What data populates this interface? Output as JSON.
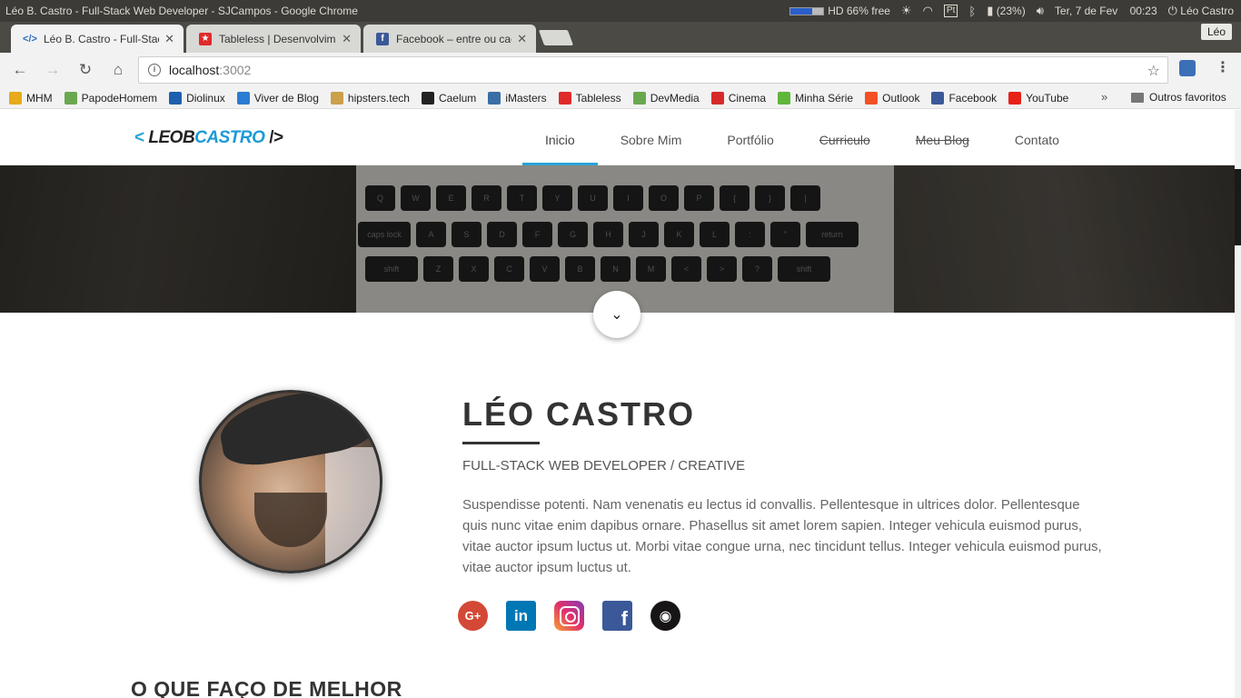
{
  "os": {
    "window_title": "Léo B. Castro - Full-Stack Web Developer - SJCampos - Google Chrome",
    "disk": "HD 66% free",
    "disk_free_fraction": 0.66,
    "keyboard": "Pt",
    "battery": "(23%)",
    "date": "Ter,  7 de Fev",
    "time": "00:23",
    "user": "Léo Castro"
  },
  "tabs": [
    {
      "title": "Léo B. Castro - Full-Stack",
      "icon": "code-icon",
      "active": true
    },
    {
      "title": "Tableless | Desenvolvim",
      "icon": "tableless-icon",
      "active": false
    },
    {
      "title": "Facebook – entre ou cad",
      "icon": "facebook-icon",
      "active": false
    }
  ],
  "profile_button": "Léo",
  "address": {
    "host": "localhost",
    "port": ":3002"
  },
  "bookmarks": [
    {
      "label": "MHM",
      "color": "#e8a91a"
    },
    {
      "label": "PapodeHomem",
      "color": "#6aa84f"
    },
    {
      "label": "Diolinux",
      "color": "#1f5fb0"
    },
    {
      "label": "Viver de Blog",
      "color": "#2b7cd3"
    },
    {
      "label": "hipsters.tech",
      "color": "#caa04a"
    },
    {
      "label": "Caelum",
      "color": "#222222"
    },
    {
      "label": "iMasters",
      "color": "#3a6ea5"
    },
    {
      "label": "Tableless",
      "color": "#e02a2a"
    },
    {
      "label": "DevMedia",
      "color": "#6aa84f"
    },
    {
      "label": "Cinema",
      "color": "#d62a2a"
    },
    {
      "label": "Minha Série",
      "color": "#5fb63a"
    },
    {
      "label": "Outlook",
      "color": "#f25022"
    },
    {
      "label": "Facebook",
      "color": "#3b5998"
    },
    {
      "label": "YouTube",
      "color": "#e62117"
    }
  ],
  "bookmarks_more": "»",
  "other_bookmarks": "Outros favoritos",
  "site": {
    "logo": {
      "left_bracket": "<",
      "first": "LEOB",
      "second": "CASTRO",
      "right_bracket": "/>"
    },
    "nav": [
      {
        "label": "Inicio",
        "active": true,
        "strike": false
      },
      {
        "label": "Sobre Mim",
        "active": false,
        "strike": false
      },
      {
        "label": "Portfólio",
        "active": false,
        "strike": false
      },
      {
        "label": "Curriculo",
        "active": false,
        "strike": true
      },
      {
        "label": "Meu Blog",
        "active": false,
        "strike": true
      },
      {
        "label": "Contato",
        "active": false,
        "strike": false
      }
    ],
    "keyboard_rows": [
      [
        "Q",
        "W",
        "E",
        "R",
        "T",
        "Y",
        "U",
        "I",
        "O",
        "P",
        "{",
        "}",
        "|"
      ],
      [
        "caps lock",
        "A",
        "S",
        "D",
        "F",
        "G",
        "H",
        "J",
        "K",
        "L",
        ":",
        "\"",
        "return"
      ],
      [
        "shift",
        "Z",
        "X",
        "C",
        "V",
        "B",
        "N",
        "M",
        "<",
        ">",
        "?",
        "shift"
      ]
    ],
    "profile": {
      "name": "LÉO CASTRO",
      "role": "FULL-STACK WEB DEVELOPER / CREATIVE",
      "bio": "Suspendisse potenti. Nam venenatis eu lectus id convallis. Pellentesque in ultrices dolor. Pellentesque quis nunc vitae enim dapibus ornare. Phasellus sit amet lorem sapien. Integer vehicula euismod purus, vitae auctor ipsum luctus ut. Morbi vitae congue urna, nec tincidunt tellus. Integer vehicula euismod purus, vitae auctor ipsum luctus ut."
    },
    "social": [
      {
        "name": "google-plus-icon",
        "glyph": "G+"
      },
      {
        "name": "linkedin-icon",
        "glyph": "in"
      },
      {
        "name": "instagram-icon",
        "glyph": ""
      },
      {
        "name": "facebook-icon",
        "glyph": "f"
      },
      {
        "name": "github-icon",
        "glyph": "◉"
      }
    ],
    "section_title": "O QUE FAÇO DE MELHOR"
  }
}
